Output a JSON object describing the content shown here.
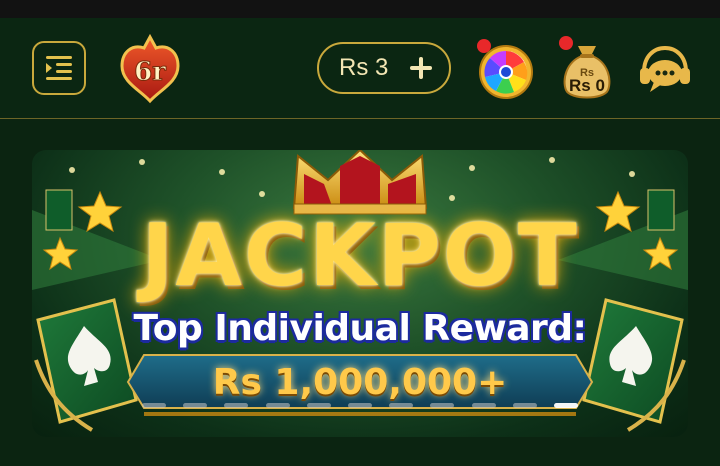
{
  "header": {
    "balance_label": "Rs 3",
    "bonus_bag_amount": "Rs 0",
    "bag_caption": "Rs",
    "logo_text": "6r"
  },
  "banner": {
    "headline": "JACKPOT",
    "subtitle": "Top Individual Reward:",
    "amount": "Rs 1,000,000+",
    "slide_count": 11,
    "active_slide": 11
  },
  "colors": {
    "background": "#0b2411",
    "accent_gold": "#c9a93c",
    "notification_dot": "#e8282a"
  },
  "icons": [
    "menu-icon",
    "logo",
    "plus-icon",
    "lucky-wheel-icon",
    "money-bag-icon",
    "customer-support-icon"
  ]
}
